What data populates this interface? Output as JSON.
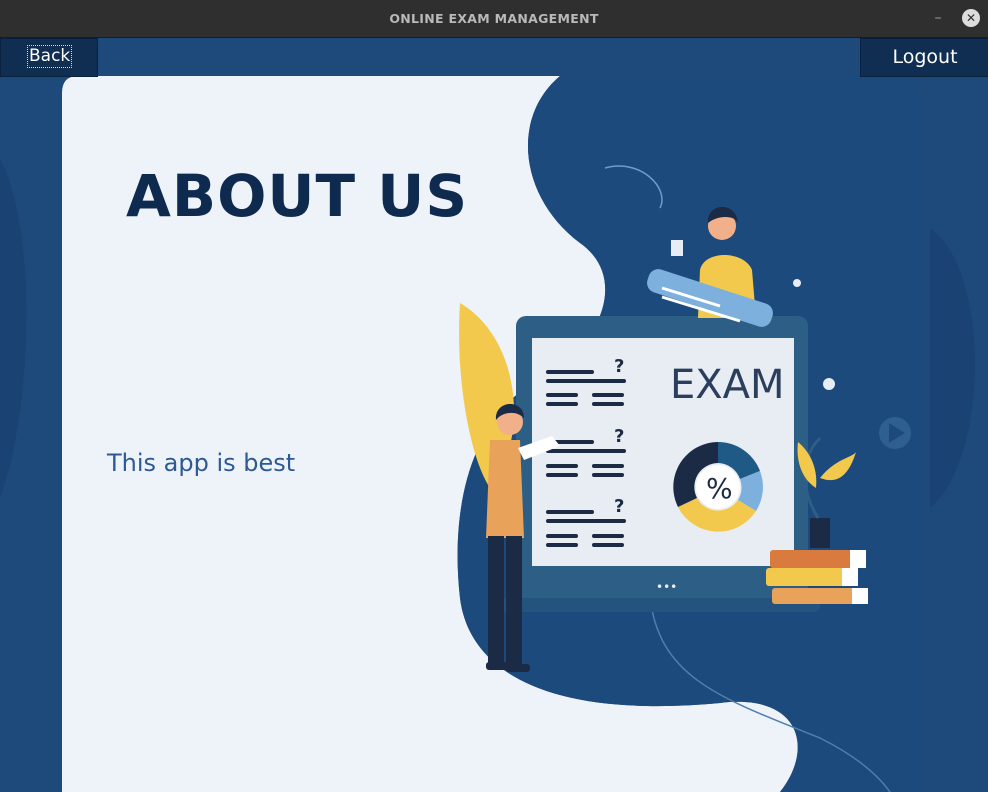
{
  "window": {
    "title": "ONLINE EXAM MANAGEMENT",
    "minimize_label": "–",
    "close_label": "✕"
  },
  "toolbar": {
    "back_label": "Back",
    "logout_label": "Logout"
  },
  "content": {
    "heading": "ABOUT US",
    "description": "This app is best",
    "illustration": {
      "board_title": "EXAM",
      "question_mark": "?",
      "chart_symbol": "%",
      "board_dots": "•••"
    }
  },
  "colors": {
    "background_blue": "#1e4a7b",
    "navy": "#0e2b4f",
    "card": "#eef2f9",
    "accent_yellow": "#f2c94c",
    "accent_orange": "#e9a25a"
  }
}
